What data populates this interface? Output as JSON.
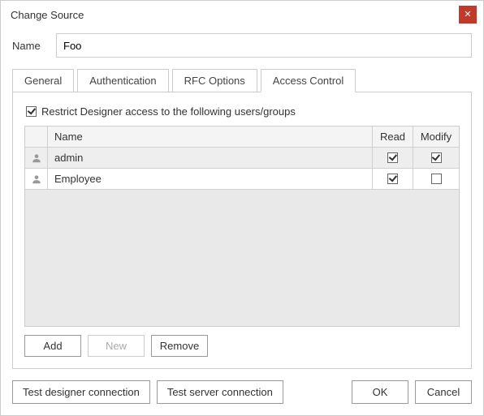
{
  "dialog": {
    "title": "Change Source",
    "close_icon": "✕"
  },
  "name_field": {
    "label": "Name",
    "value": "Foo"
  },
  "tabs": {
    "general": "General",
    "authentication": "Authentication",
    "rfc_options": "RFC Options",
    "access_control": "Access Control"
  },
  "access": {
    "restrict_label": "Restrict Designer access to the following users/groups",
    "restrict_checked": true,
    "columns": {
      "name": "Name",
      "read": "Read",
      "modify": "Modify"
    },
    "rows": [
      {
        "name": "admin",
        "read": true,
        "modify": true
      },
      {
        "name": "Employee",
        "read": true,
        "modify": false
      }
    ],
    "buttons": {
      "add": "Add",
      "new": "New",
      "remove": "Remove"
    }
  },
  "footer": {
    "test_designer": "Test designer connection",
    "test_server": "Test server connection",
    "ok": "OK",
    "cancel": "Cancel"
  }
}
